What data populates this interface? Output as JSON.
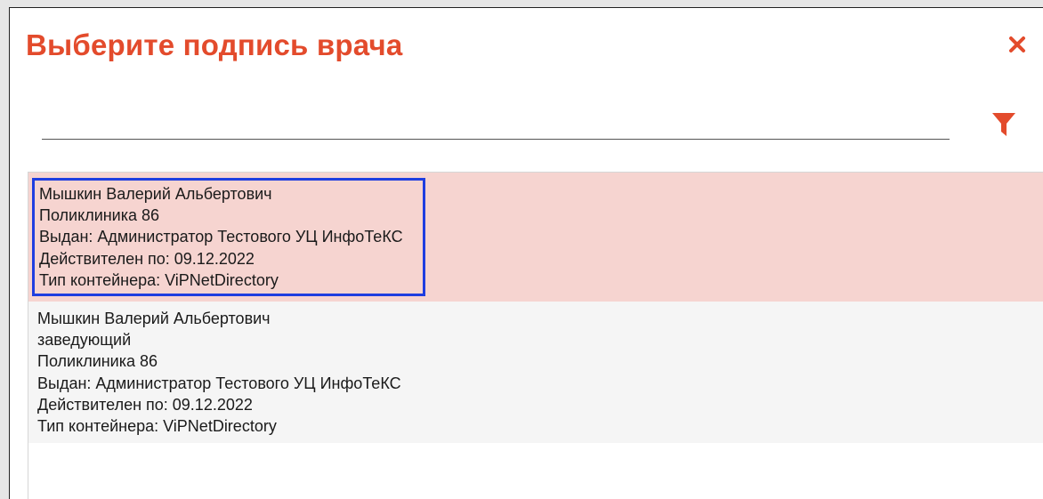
{
  "dialog": {
    "title": "Выберите подпись врача",
    "close_icon": "close-icon",
    "filter_icon": "filter-icon",
    "accent_color": "#e34b2c",
    "search": {
      "value": "",
      "placeholder": ""
    }
  },
  "certificates": [
    {
      "selected": true,
      "name": "Мышкин Валерий Альбертович",
      "organization": "Поликлиника 86",
      "issuer": "Выдан: Администратор Тестового УЦ ИнфоТеКС",
      "valid_until": "Действителен по: 09.12.2022",
      "container": "Тип контейнера: ViPNetDirectory"
    },
    {
      "selected": false,
      "name": "Мышкин Валерий Альбертович",
      "position": "заведующий",
      "organization": "Поликлиника 86",
      "issuer": "Выдан: Администратор Тестового УЦ ИнфоТеКС",
      "valid_until": "Действителен по: 09.12.2022",
      "container": "Тип контейнера: ViPNetDirectory"
    }
  ]
}
